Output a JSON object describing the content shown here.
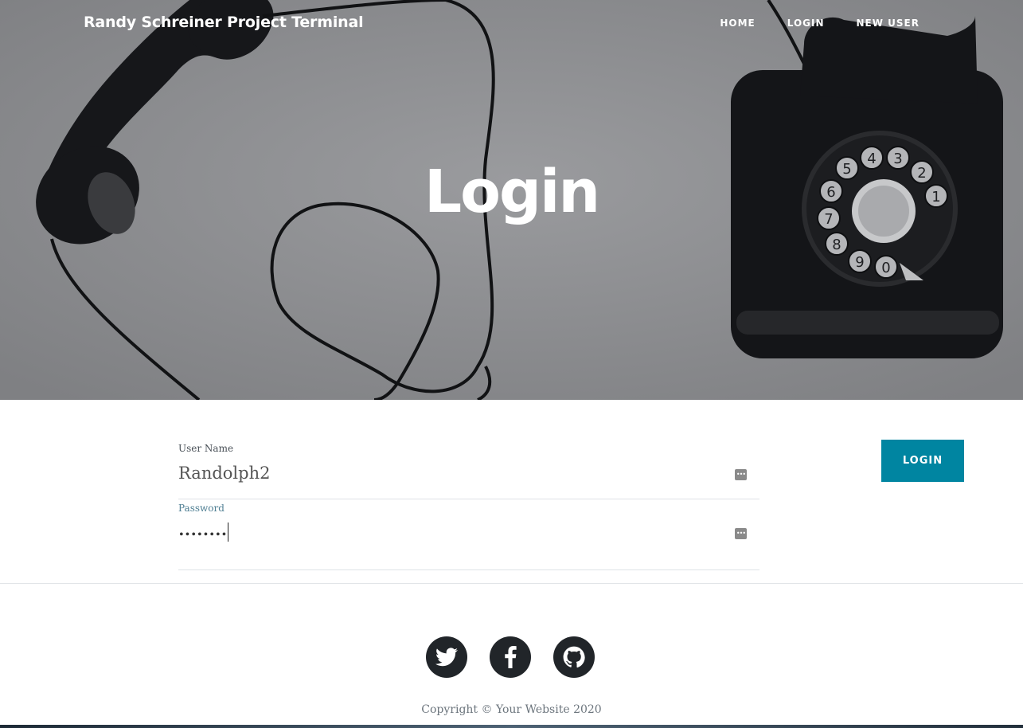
{
  "nav": {
    "brand": "Randy Schreiner Project Terminal",
    "links": [
      "HOME",
      "LOGIN",
      "NEW USER"
    ]
  },
  "hero": {
    "title": "Login"
  },
  "form": {
    "username_label": "User Name",
    "username_value": "Randolph2",
    "password_label": "Password",
    "password_value": "••••••••",
    "submit_label": "LOGIN"
  },
  "footer": {
    "social_icons": [
      "twitter-icon",
      "facebook-icon",
      "github-icon"
    ],
    "copyright": "Copyright © Your Website 2020"
  },
  "colors": {
    "accent": "#0085a1",
    "hero_overlay": "#8c8d90",
    "social_bg": "#212529"
  }
}
